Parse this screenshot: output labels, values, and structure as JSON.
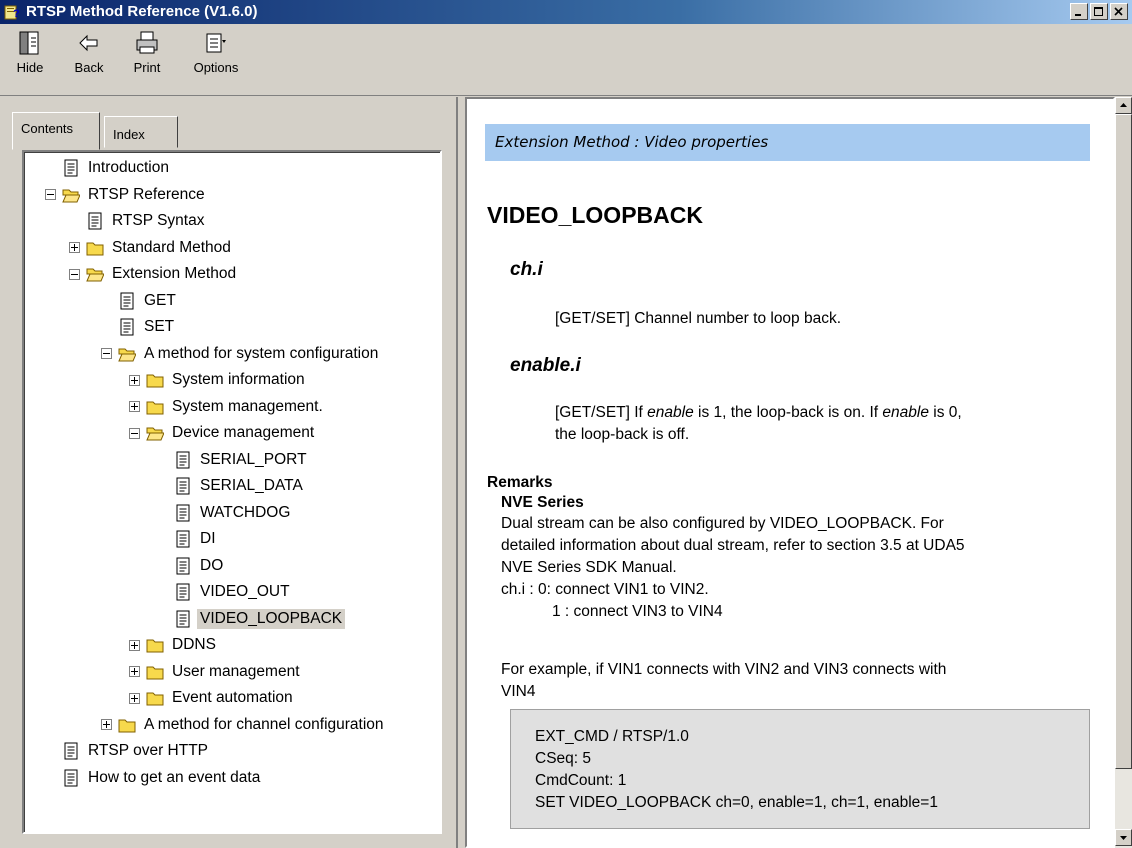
{
  "window": {
    "title": "RTSP Method Reference (V1.6.0)"
  },
  "toolbar": {
    "hide": "Hide",
    "back": "Back",
    "print": "Print",
    "options": "Options"
  },
  "tabs": {
    "contents": "Contents",
    "index": "Index"
  },
  "tree": [
    {
      "label": "Introduction",
      "type": "page",
      "depth": 0
    },
    {
      "label": "RTSP Reference",
      "type": "folder-open",
      "depth": 0,
      "expander": "minus"
    },
    {
      "label": "RTSP Syntax",
      "type": "page",
      "depth": 1
    },
    {
      "label": "Standard Method",
      "type": "folder",
      "depth": 1,
      "expander": "plus"
    },
    {
      "label": "Extension Method",
      "type": "folder-open",
      "depth": 1,
      "expander": "minus"
    },
    {
      "label": "GET",
      "type": "page",
      "depth": 2
    },
    {
      "label": "SET",
      "type": "page",
      "depth": 2
    },
    {
      "label": "A method for system configuration",
      "type": "folder-open",
      "depth": 2,
      "expander": "minus"
    },
    {
      "label": "System information",
      "type": "folder",
      "depth": 3,
      "expander": "plus"
    },
    {
      "label": "System management.",
      "type": "folder",
      "depth": 3,
      "expander": "plus"
    },
    {
      "label": "Device management",
      "type": "folder-open",
      "depth": 3,
      "expander": "minus"
    },
    {
      "label": "SERIAL_PORT",
      "type": "page",
      "depth": 4
    },
    {
      "label": "SERIAL_DATA",
      "type": "page",
      "depth": 4
    },
    {
      "label": "WATCHDOG",
      "type": "page",
      "depth": 4
    },
    {
      "label": "DI",
      "type": "page",
      "depth": 4
    },
    {
      "label": "DO",
      "type": "page",
      "depth": 4
    },
    {
      "label": "VIDEO_OUT",
      "type": "page",
      "depth": 4
    },
    {
      "label": "VIDEO_LOOPBACK",
      "type": "page",
      "depth": 4,
      "selected": true
    },
    {
      "label": "DDNS",
      "type": "folder",
      "depth": 3,
      "expander": "plus"
    },
    {
      "label": "User management",
      "type": "folder",
      "depth": 3,
      "expander": "plus"
    },
    {
      "label": "Event automation",
      "type": "folder",
      "depth": 3,
      "expander": "plus"
    },
    {
      "label": "A method for channel configuration",
      "type": "folder",
      "depth": 2,
      "expander": "plus"
    },
    {
      "label": "RTSP over HTTP",
      "type": "page",
      "depth": 0
    },
    {
      "label": "How to get an event data",
      "type": "page",
      "depth": 0
    }
  ],
  "doc": {
    "banner": "Extension Method : Video properties",
    "heading": "VIDEO_LOOPBACK",
    "param1_name": "ch.i",
    "param1_desc": "[GET/SET] Channel number to loop back.",
    "param2_name": "enable.i",
    "param2_desc_a": "[GET/SET] If ",
    "param2_desc_b": "enable",
    "param2_desc_c": " is 1, the loop-back is on. If ",
    "param2_desc_d": "enable",
    "param2_desc_e": " is 0,",
    "param2_desc_line2": "the loop-back is off.",
    "remarks": "Remarks",
    "series": "NVE Series",
    "remark_line1": "Dual stream can be also configured by VIDEO_LOOPBACK. For",
    "remark_line2": "detailed information about dual stream, refer to section 3.5 at UDA5",
    "remark_line3": "NVE Series SDK Manual.",
    "chi_line1": "ch.i :  0: connect VIN1 to VIN2.",
    "chi_line2": "1 : connect VIN3 to VIN4",
    "example_line1": "For example, if VIN1 connects with VIN2 and VIN3 connects with",
    "example_line2": "VIN4",
    "code": [
      "EXT_CMD / RTSP/1.0",
      "CSeq: 5",
      "CmdCount: 1",
      "SET VIDEO_LOOPBACK ch=0, enable=1, ch=1, enable=1"
    ]
  }
}
